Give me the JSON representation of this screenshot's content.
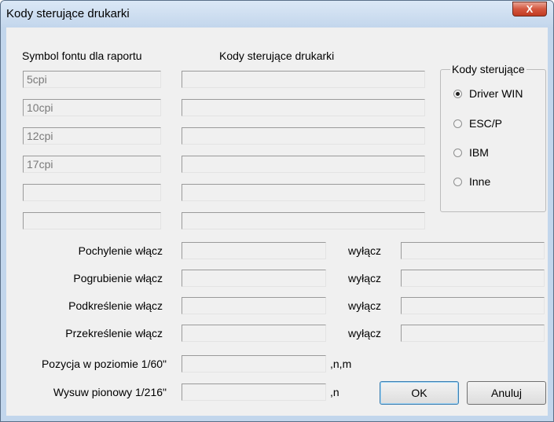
{
  "window": {
    "title": "Kody sterujące drukarki",
    "close_label": "X"
  },
  "headers": {
    "symbol": "Symbol fontu dla raportu",
    "codes": "Kody sterujące drukarki"
  },
  "font_rows": [
    {
      "symbol": "5cpi",
      "code": ""
    },
    {
      "symbol": "10cpi",
      "code": ""
    },
    {
      "symbol": "12cpi",
      "code": ""
    },
    {
      "symbol": "17cpi",
      "code": ""
    },
    {
      "symbol": "",
      "code": ""
    },
    {
      "symbol": "",
      "code": ""
    }
  ],
  "codes_group": {
    "title": "Kody sterujące",
    "options": [
      {
        "label": "Driver WIN",
        "checked": true
      },
      {
        "label": "ESC/P",
        "checked": false
      },
      {
        "label": "IBM",
        "checked": false
      },
      {
        "label": "Inne",
        "checked": false
      }
    ]
  },
  "style_rows": [
    {
      "label": "Pochylenie włącz",
      "on_value": "",
      "off_label": "wyłącz",
      "off_value": ""
    },
    {
      "label": "Pogrubienie włącz",
      "on_value": "",
      "off_label": "wyłącz",
      "off_value": ""
    },
    {
      "label": "Podkreślenie włącz",
      "on_value": "",
      "off_label": "wyłącz",
      "off_value": ""
    },
    {
      "label": "Przekreślenie włącz",
      "on_value": "",
      "off_label": "wyłącz",
      "off_value": ""
    }
  ],
  "position_row": {
    "label": "Pozycja w poziomie 1/60\"",
    "value": "",
    "suffix": ",n,m"
  },
  "feed_row": {
    "label": "Wysuw pionowy 1/216\"",
    "value": "",
    "suffix": ",n"
  },
  "buttons": {
    "ok": "OK",
    "cancel": "Anuluj"
  }
}
